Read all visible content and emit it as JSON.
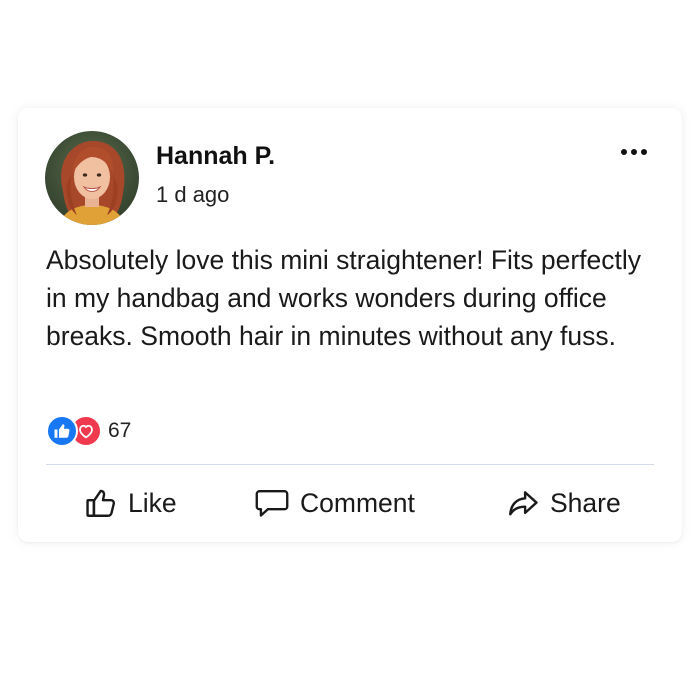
{
  "post": {
    "author": "Hannah P.",
    "timestamp": "1 d ago",
    "text": "Absolutely love this mini straightener! Fits perfectly in my handbag and works wonders during office breaks. Smooth hair in minutes without any fuss.",
    "more_icon": "more-horizontal-icon"
  },
  "reactions": {
    "icons": [
      "like-reaction-icon",
      "love-reaction-icon"
    ],
    "count": "67"
  },
  "actions": {
    "like": {
      "label": "Like",
      "icon": "thumbs-up-icon"
    },
    "comment": {
      "label": "Comment",
      "icon": "speech-bubble-icon"
    },
    "share": {
      "label": "Share",
      "icon": "share-arrow-icon"
    }
  },
  "colors": {
    "like_blue": "#1877f2",
    "love_red": "#f0394e",
    "divider": "#d4d8ec"
  }
}
